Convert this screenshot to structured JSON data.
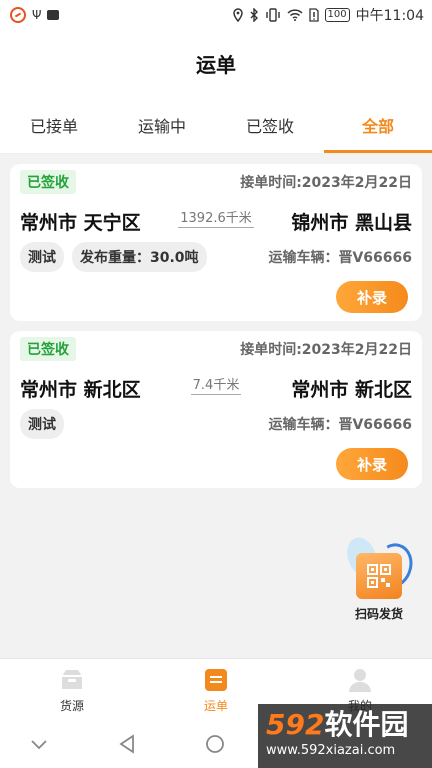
{
  "status_bar": {
    "battery": "100",
    "time": "中午11:04"
  },
  "header": {
    "title": "运单"
  },
  "tabs": [
    {
      "label": "已接单",
      "active": false
    },
    {
      "label": "运输中",
      "active": false
    },
    {
      "label": "已签收",
      "active": false
    },
    {
      "label": "全部",
      "active": true
    }
  ],
  "orders": [
    {
      "status": "已签收",
      "accept_time": "接单时间:2023年2月22日",
      "origin": "常州市 天宁区",
      "distance": "1392.6千米",
      "destination": "锦州市 黑山县",
      "chips": [
        "测试",
        "发布重量：30.0吨"
      ],
      "vehicle": "运输车辆：晋V66666",
      "action": "补录"
    },
    {
      "status": "已签收",
      "accept_time": "接单时间:2023年2月22日",
      "origin": "常州市 新北区",
      "distance": "7.4千米",
      "destination": "常州市 新北区",
      "chips": [
        "测试"
      ],
      "vehicle": "运输车辆：晋V66666",
      "action": "补录"
    }
  ],
  "scan_button": {
    "label": "扫码发货"
  },
  "bottom_nav": [
    {
      "label": "货源",
      "active": false
    },
    {
      "label": "运单",
      "active": true
    },
    {
      "label": "我的",
      "active": false
    }
  ],
  "watermark": {
    "big_num": "592",
    "big_text": "软件园",
    "url": "www.592xiazai.com"
  },
  "colors": {
    "accent": "#f28a1d",
    "badge_green": "#25a33a"
  }
}
